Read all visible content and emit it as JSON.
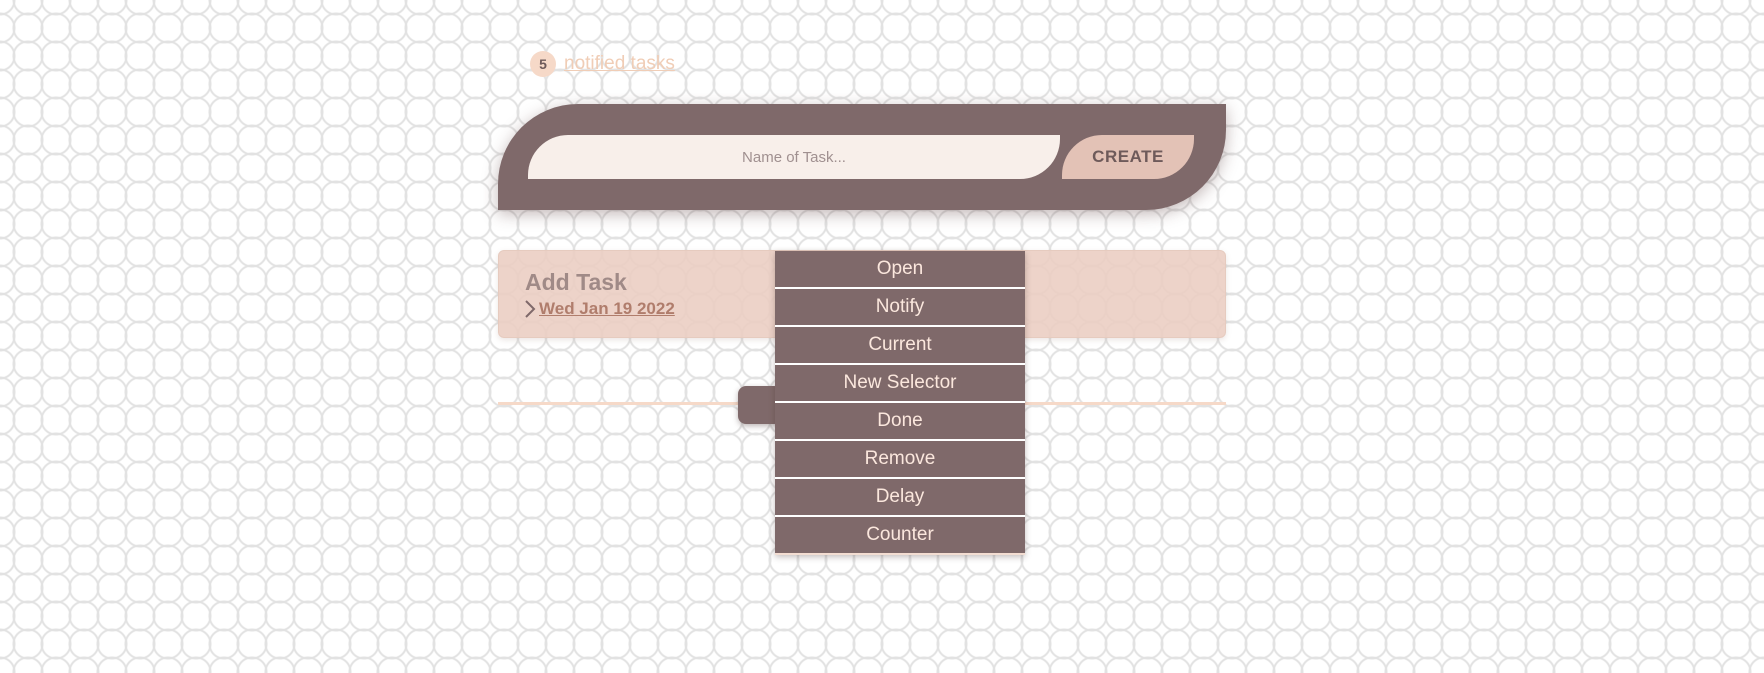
{
  "notified": {
    "count": "5",
    "label": "notified tasks"
  },
  "create_bar": {
    "placeholder": "Name of Task...",
    "create_label": "CREATE"
  },
  "task": {
    "title": "Add Task",
    "date": "Wed Jan 19 2022"
  },
  "context_menu": {
    "items": [
      {
        "label": "Open"
      },
      {
        "label": "Notify"
      },
      {
        "label": "Current"
      },
      {
        "label": "New Selector"
      },
      {
        "label": "Done"
      },
      {
        "label": "Remove"
      },
      {
        "label": "Delay"
      },
      {
        "label": "Counter"
      }
    ]
  },
  "colors": {
    "primary": "#7f696a",
    "accent": "#e3c2b6",
    "card": "#eacdc1",
    "menu_text": "#fbe7dd",
    "link": "#f0cdb6"
  },
  "icons": {
    "date_expander": "chevron-right-icon"
  }
}
